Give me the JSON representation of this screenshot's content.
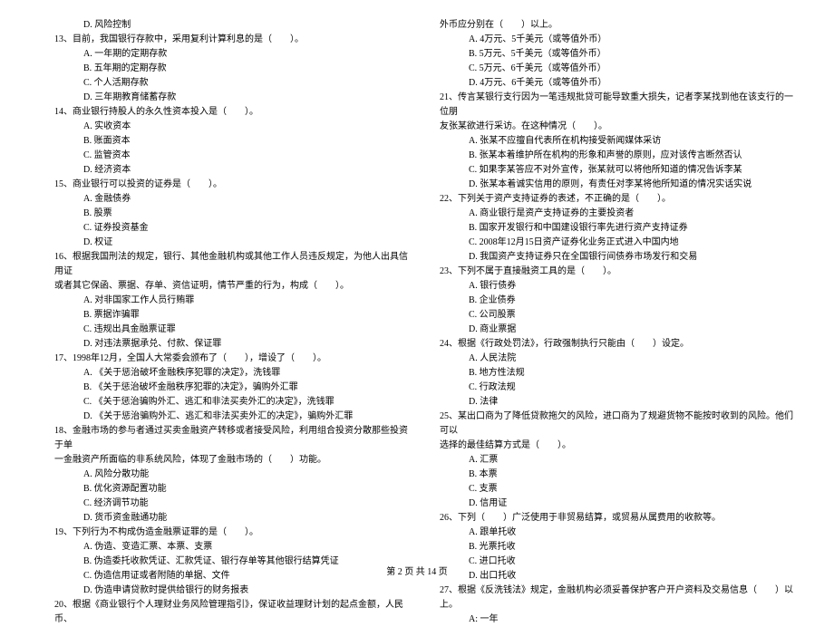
{
  "left": {
    "q12_D": "D. 风险控制",
    "q13": "13、目前，我国银行存款中，采用复利计算利息的是（　　）。",
    "q13_A": "A. 一年期的定期存款",
    "q13_B": "B. 五年期的定期存款",
    "q13_C": "C. 个人活期存款",
    "q13_D": "D. 三年期教育储蓄存款",
    "q14": "14、商业银行持股人的永久性资本投入是（　　）。",
    "q14_A": "A. 实收资本",
    "q14_B": "B. 账面资本",
    "q14_C": "C. 监管资本",
    "q14_D": "D. 经济资本",
    "q15": "15、商业银行可以投资的证券是（　　）。",
    "q15_A": "A. 金融债券",
    "q15_B": "B. 股票",
    "q15_C": "C. 证券投资基金",
    "q15_D": "D. 权证",
    "q16": "16、根据我国刑法的规定，银行、其他金融机构或其他工作人员违反规定，为他人出具信用证",
    "q16b": "或者其它保函、票据、存单、资信证明，情节严重的行为，构成（　　）。",
    "q16_A": "A. 对非国家工作人员行贿罪",
    "q16_B": "B. 票据诈骗罪",
    "q16_C": "C. 违规出具金融票证罪",
    "q16_D": "D. 对违法票据承兑、付款、保证罪",
    "q17": "17、1998年12月，全国人大常委会颁布了（　　），增设了（　　）。",
    "q17_A": "A. 《关于惩治破坏金融秩序犯罪的决定》，洗钱罪",
    "q17_B": "B. 《关于惩治破坏金融秩序犯罪的决定》，骗购外汇罪",
    "q17_C": "C. 《关于惩治骗购外汇、逃汇和非法买卖外汇的决定》，洗钱罪",
    "q17_D": "D. 《关于惩治骗购外汇、逃汇和非法买卖外汇的决定》，骗购外汇罪",
    "q18": "18、金融市场的参与者通过买卖金融资产转移或者接受风险，利用组合投资分散那些投资于单",
    "q18b": "一金融资产所面临的非系统风险，体现了金融市场的（　　）功能。",
    "q18_A": "A. 风险分散功能",
    "q18_B": "B. 优化资源配置功能",
    "q18_C": "C. 经济调节功能",
    "q18_D": "D. 货币资金融通功能",
    "q19": "19、下列行为不构成伪造金融票证罪的是（　　）。",
    "q19_A": "A. 伪造、变造汇票、本票、支票",
    "q19_B": "B. 伪造委托收款凭证、汇款凭证、银行存单等其他银行结算凭证",
    "q19_C": "C. 伪造信用证或者附随的单据、文件",
    "q19_D": "D. 伪造申请贷款时提供给银行的财务报表",
    "q20": "20、根据《商业银行个人理财业务风险管理指引》，保证收益理财计划的起点金额，人民币、"
  },
  "right": {
    "q20b": "外币应分别在（　　）以上。",
    "q20_A": "A. 4万元、5千美元（或等值外币）",
    "q20_B": "B. 5万元、5千美元（或等值外币）",
    "q20_C": "C. 5万元、6千美元（或等值外币）",
    "q20_D": "D. 4万元、6千美元（或等值外币）",
    "q21": "21、传言某银行支行因为一笔违规批贷可能导致重大损失，记者李某找到他在该支行的一位朋",
    "q21b": "友张某欲进行采访。在这种情况（　　）。",
    "q21_A": "A. 张某不应擅自代表所在机构接受新闻媒体采访",
    "q21_B": "B. 张某本着维护所在机构的形象和声誉的原则，应对该传言断然否认",
    "q21_C": "C. 如果李某答应不对外宣传，张某就可以将他所知道的情况告诉李某",
    "q21_D": "D. 张某本着诚实信用的原则，有责任对李某将他所知道的情况实话实说",
    "q22": "22、下列关于资产支持证券的表述，不正确的是（　　）。",
    "q22_A": "A. 商业银行是资产支持证券的主要投资者",
    "q22_B": "B. 国家开发银行和中国建设银行率先进行资产支持证券",
    "q22_C": "C. 2008年12月15日资产证券化业务正式进入中国内地",
    "q22_D": "D. 我国资产支持证券只在全国银行间债券市场发行和交易",
    "q23": "23、下列不属于直接融资工具的是（　　）。",
    "q23_A": "A. 银行债券",
    "q23_B": "B. 企业债券",
    "q23_C": "C. 公司股票",
    "q23_D": "D. 商业票据",
    "q24": "24、根据《行政处罚法》，行政强制执行只能由（　　）设定。",
    "q24_A": "A. 人民法院",
    "q24_B": "B. 地方性法规",
    "q24_C": "C. 行政法规",
    "q24_D": "D. 法律",
    "q25": "25、某出口商为了降低贷款拖欠的风险，进口商为了规避货物不能按时收到的风险。他们可以",
    "q25b": "选择的最佳结算方式是（　　）。",
    "q25_A": "A. 汇票",
    "q25_B": "B. 本票",
    "q25_C": "C. 支票",
    "q25_D": "D. 信用证",
    "q26": "26、下列（　　）广泛使用于非贸易结算，或贸易从属费用的收款等。",
    "q26_A": "A. 跟单托收",
    "q26_B": "B. 光票托收",
    "q26_C": "C. 进口托收",
    "q26_D": "D. 出口托收",
    "q27": "27、根据《反洗钱法》规定，金融机构必须妥善保护客户开户资料及交易信息（　　）以上。",
    "q27_A": "A: 一年"
  },
  "footer": "第 2 页 共 14 页"
}
